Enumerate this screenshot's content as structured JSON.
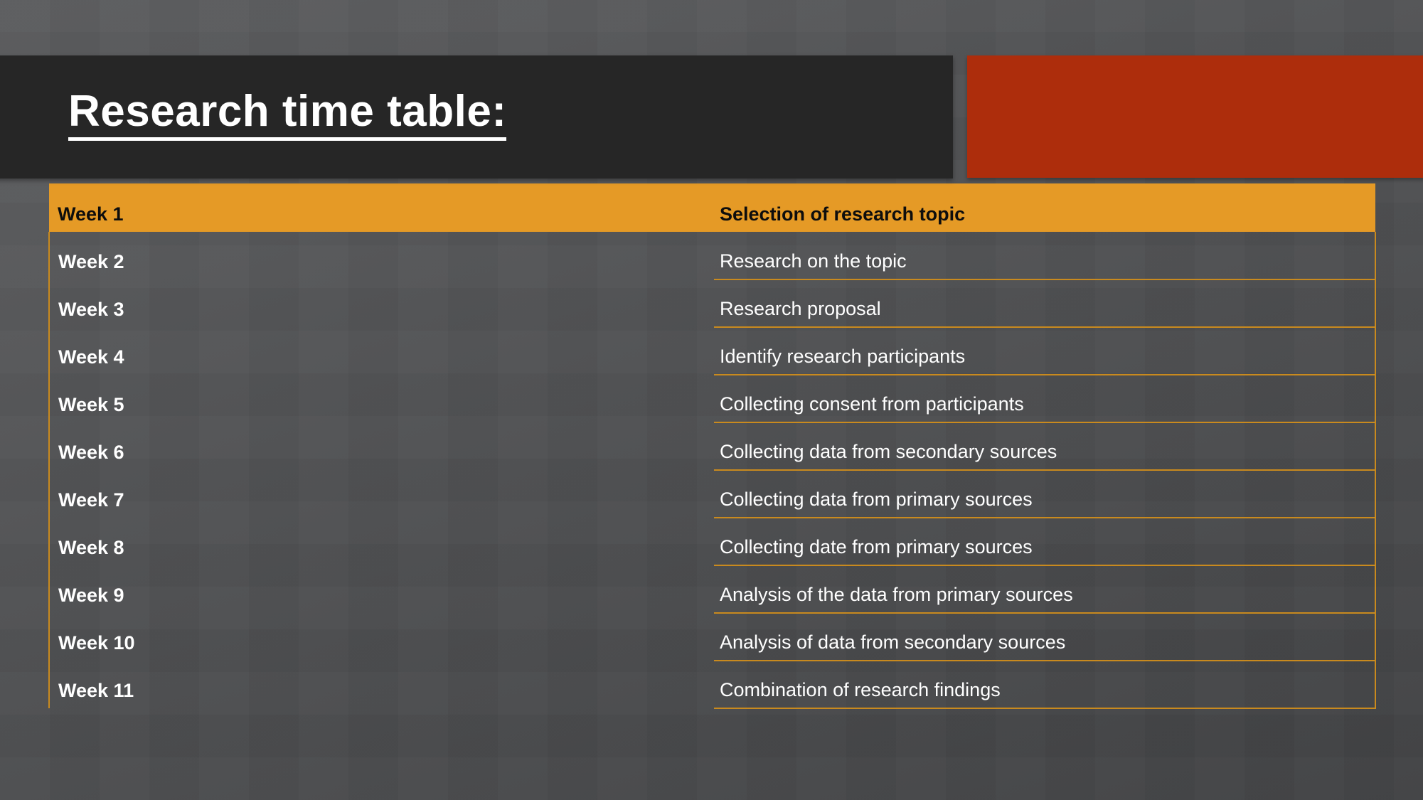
{
  "slide": {
    "title": "Research time table:",
    "accent_orange": "#E59A26",
    "accent_red": "#AD2D0C",
    "banner_dark": "#262626",
    "background_gray": "#4f5052"
  },
  "table": {
    "columns": [
      "Week 1",
      "Selection of research topic"
    ],
    "header": {
      "week": "Week 1",
      "task": "Selection of research topic"
    },
    "rows": [
      {
        "week": "Week 2",
        "task": "Research on the topic"
      },
      {
        "week": "Week 3",
        "task": "Research proposal"
      },
      {
        "week": "Week 4",
        "task": "Identify research participants"
      },
      {
        "week": "Week 5",
        "task": "Collecting consent from participants"
      },
      {
        "week": "Week 6",
        "task": "Collecting data from secondary sources"
      },
      {
        "week": "Week 7",
        "task": "Collecting data from primary sources"
      },
      {
        "week": "Week 8",
        "task": "Collecting date from primary sources"
      },
      {
        "week": "Week 9",
        "task": "Analysis of the data from primary sources"
      },
      {
        "week": "Week 10",
        "task": "Analysis of data from secondary sources"
      },
      {
        "week": "Week 11",
        "task": "Combination of research findings"
      }
    ]
  }
}
